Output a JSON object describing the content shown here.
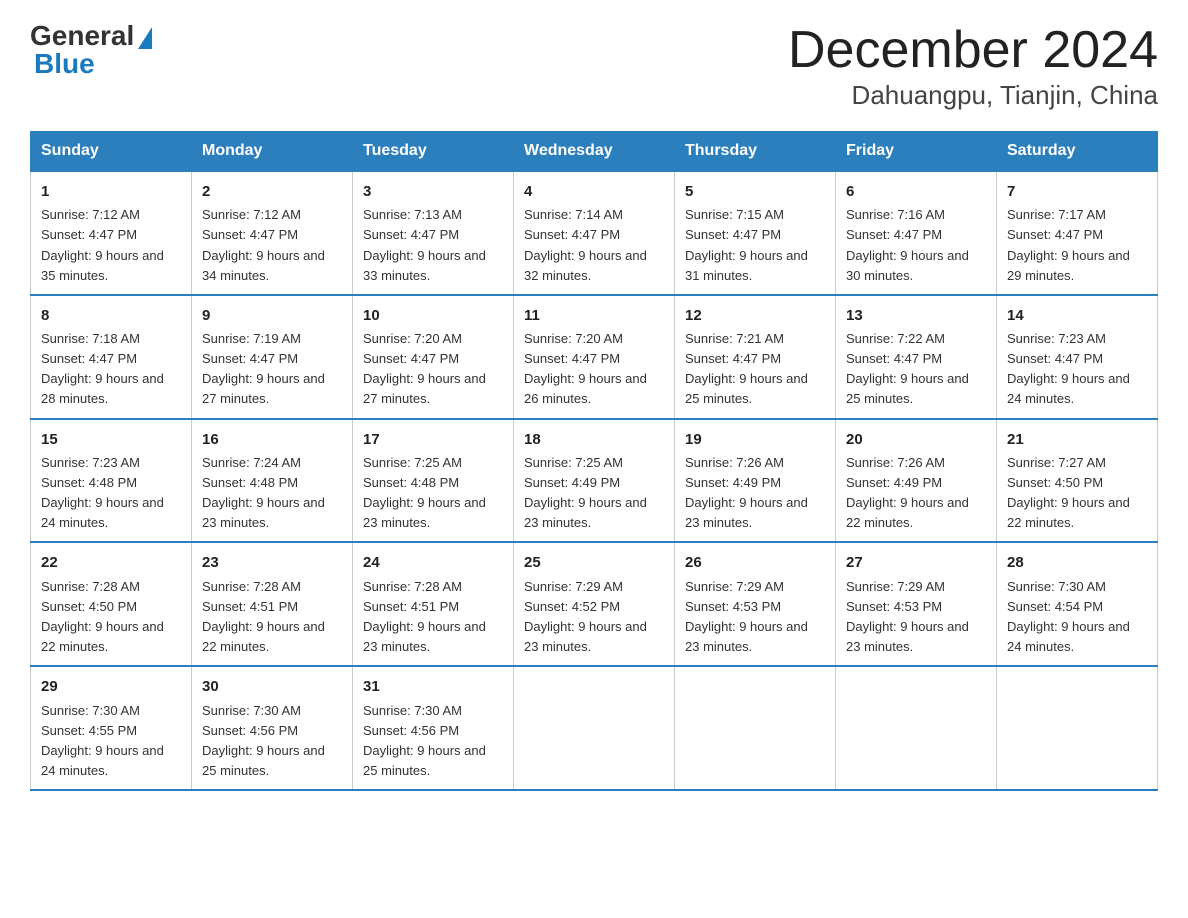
{
  "header": {
    "logo_general": "General",
    "logo_blue": "Blue",
    "title": "December 2024",
    "subtitle": "Dahuangpu, Tianjin, China"
  },
  "days_of_week": [
    "Sunday",
    "Monday",
    "Tuesday",
    "Wednesday",
    "Thursday",
    "Friday",
    "Saturday"
  ],
  "weeks": [
    [
      {
        "day": "1",
        "sunrise": "7:12 AM",
        "sunset": "4:47 PM",
        "daylight": "9 hours and 35 minutes."
      },
      {
        "day": "2",
        "sunrise": "7:12 AM",
        "sunset": "4:47 PM",
        "daylight": "9 hours and 34 minutes."
      },
      {
        "day": "3",
        "sunrise": "7:13 AM",
        "sunset": "4:47 PM",
        "daylight": "9 hours and 33 minutes."
      },
      {
        "day": "4",
        "sunrise": "7:14 AM",
        "sunset": "4:47 PM",
        "daylight": "9 hours and 32 minutes."
      },
      {
        "day": "5",
        "sunrise": "7:15 AM",
        "sunset": "4:47 PM",
        "daylight": "9 hours and 31 minutes."
      },
      {
        "day": "6",
        "sunrise": "7:16 AM",
        "sunset": "4:47 PM",
        "daylight": "9 hours and 30 minutes."
      },
      {
        "day": "7",
        "sunrise": "7:17 AM",
        "sunset": "4:47 PM",
        "daylight": "9 hours and 29 minutes."
      }
    ],
    [
      {
        "day": "8",
        "sunrise": "7:18 AM",
        "sunset": "4:47 PM",
        "daylight": "9 hours and 28 minutes."
      },
      {
        "day": "9",
        "sunrise": "7:19 AM",
        "sunset": "4:47 PM",
        "daylight": "9 hours and 27 minutes."
      },
      {
        "day": "10",
        "sunrise": "7:20 AM",
        "sunset": "4:47 PM",
        "daylight": "9 hours and 27 minutes."
      },
      {
        "day": "11",
        "sunrise": "7:20 AM",
        "sunset": "4:47 PM",
        "daylight": "9 hours and 26 minutes."
      },
      {
        "day": "12",
        "sunrise": "7:21 AM",
        "sunset": "4:47 PM",
        "daylight": "9 hours and 25 minutes."
      },
      {
        "day": "13",
        "sunrise": "7:22 AM",
        "sunset": "4:47 PM",
        "daylight": "9 hours and 25 minutes."
      },
      {
        "day": "14",
        "sunrise": "7:23 AM",
        "sunset": "4:47 PM",
        "daylight": "9 hours and 24 minutes."
      }
    ],
    [
      {
        "day": "15",
        "sunrise": "7:23 AM",
        "sunset": "4:48 PM",
        "daylight": "9 hours and 24 minutes."
      },
      {
        "day": "16",
        "sunrise": "7:24 AM",
        "sunset": "4:48 PM",
        "daylight": "9 hours and 23 minutes."
      },
      {
        "day": "17",
        "sunrise": "7:25 AM",
        "sunset": "4:48 PM",
        "daylight": "9 hours and 23 minutes."
      },
      {
        "day": "18",
        "sunrise": "7:25 AM",
        "sunset": "4:49 PM",
        "daylight": "9 hours and 23 minutes."
      },
      {
        "day": "19",
        "sunrise": "7:26 AM",
        "sunset": "4:49 PM",
        "daylight": "9 hours and 23 minutes."
      },
      {
        "day": "20",
        "sunrise": "7:26 AM",
        "sunset": "4:49 PM",
        "daylight": "9 hours and 22 minutes."
      },
      {
        "day": "21",
        "sunrise": "7:27 AM",
        "sunset": "4:50 PM",
        "daylight": "9 hours and 22 minutes."
      }
    ],
    [
      {
        "day": "22",
        "sunrise": "7:28 AM",
        "sunset": "4:50 PM",
        "daylight": "9 hours and 22 minutes."
      },
      {
        "day": "23",
        "sunrise": "7:28 AM",
        "sunset": "4:51 PM",
        "daylight": "9 hours and 22 minutes."
      },
      {
        "day": "24",
        "sunrise": "7:28 AM",
        "sunset": "4:51 PM",
        "daylight": "9 hours and 23 minutes."
      },
      {
        "day": "25",
        "sunrise": "7:29 AM",
        "sunset": "4:52 PM",
        "daylight": "9 hours and 23 minutes."
      },
      {
        "day": "26",
        "sunrise": "7:29 AM",
        "sunset": "4:53 PM",
        "daylight": "9 hours and 23 minutes."
      },
      {
        "day": "27",
        "sunrise": "7:29 AM",
        "sunset": "4:53 PM",
        "daylight": "9 hours and 23 minutes."
      },
      {
        "day": "28",
        "sunrise": "7:30 AM",
        "sunset": "4:54 PM",
        "daylight": "9 hours and 24 minutes."
      }
    ],
    [
      {
        "day": "29",
        "sunrise": "7:30 AM",
        "sunset": "4:55 PM",
        "daylight": "9 hours and 24 minutes."
      },
      {
        "day": "30",
        "sunrise": "7:30 AM",
        "sunset": "4:56 PM",
        "daylight": "9 hours and 25 minutes."
      },
      {
        "day": "31",
        "sunrise": "7:30 AM",
        "sunset": "4:56 PM",
        "daylight": "9 hours and 25 minutes."
      },
      null,
      null,
      null,
      null
    ]
  ]
}
